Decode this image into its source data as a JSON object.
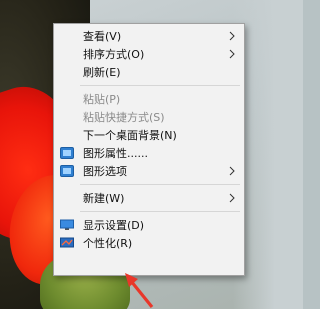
{
  "menu": {
    "view": "查看(V)",
    "sort": "排序方式(O)",
    "refresh": "刷新(E)",
    "paste": "粘贴(P)",
    "paste_shortcut": "粘贴快捷方式(S)",
    "next_background": "下一个桌面背景(N)",
    "graphics_properties": "图形属性......",
    "graphics_options": "图形选项",
    "new": "新建(W)",
    "display_settings": "显示设置(D)",
    "personalize": "个性化(R)"
  },
  "colors": {
    "arrow": "#e8372a",
    "icon_blue": "#2f7fd0"
  }
}
